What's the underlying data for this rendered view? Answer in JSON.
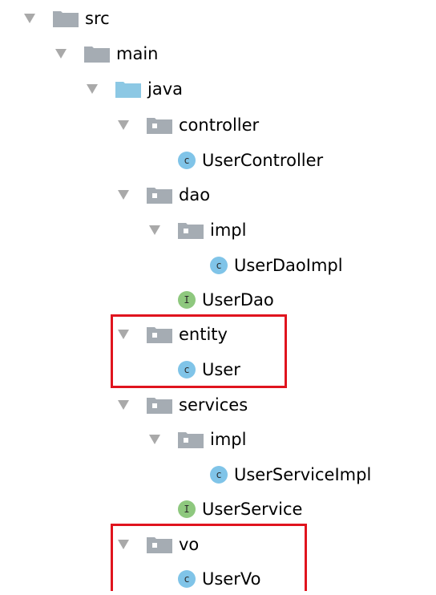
{
  "project_tree": {
    "src": {
      "label": "src"
    },
    "main": {
      "label": "main"
    },
    "java": {
      "label": "java"
    },
    "controller": {
      "label": "controller"
    },
    "user_controller": {
      "label": "UserController",
      "badge": "c"
    },
    "dao": {
      "label": "dao"
    },
    "dao_impl": {
      "label": "impl"
    },
    "user_dao_impl": {
      "label": "UserDaoImpl",
      "badge": "c"
    },
    "user_dao": {
      "label": "UserDao",
      "badge": "I"
    },
    "entity": {
      "label": "entity"
    },
    "user": {
      "label": "User",
      "badge": "c"
    },
    "services": {
      "label": "services"
    },
    "services_impl": {
      "label": "impl"
    },
    "user_service_impl": {
      "label": "UserServiceImpl",
      "badge": "c"
    },
    "user_service": {
      "label": "UserService",
      "badge": "I"
    },
    "vo": {
      "label": "vo"
    },
    "user_vo": {
      "label": "UserVo",
      "badge": "c"
    }
  },
  "colors": {
    "class_badge": "#80c4e8",
    "interface_badge": "#8ec87e",
    "source_folder": "#8cc8e4",
    "folder": "#a5acb3",
    "package_dot": "#ffffff",
    "highlight_box": "#e0141e",
    "arrow": "#a9a9a9"
  }
}
